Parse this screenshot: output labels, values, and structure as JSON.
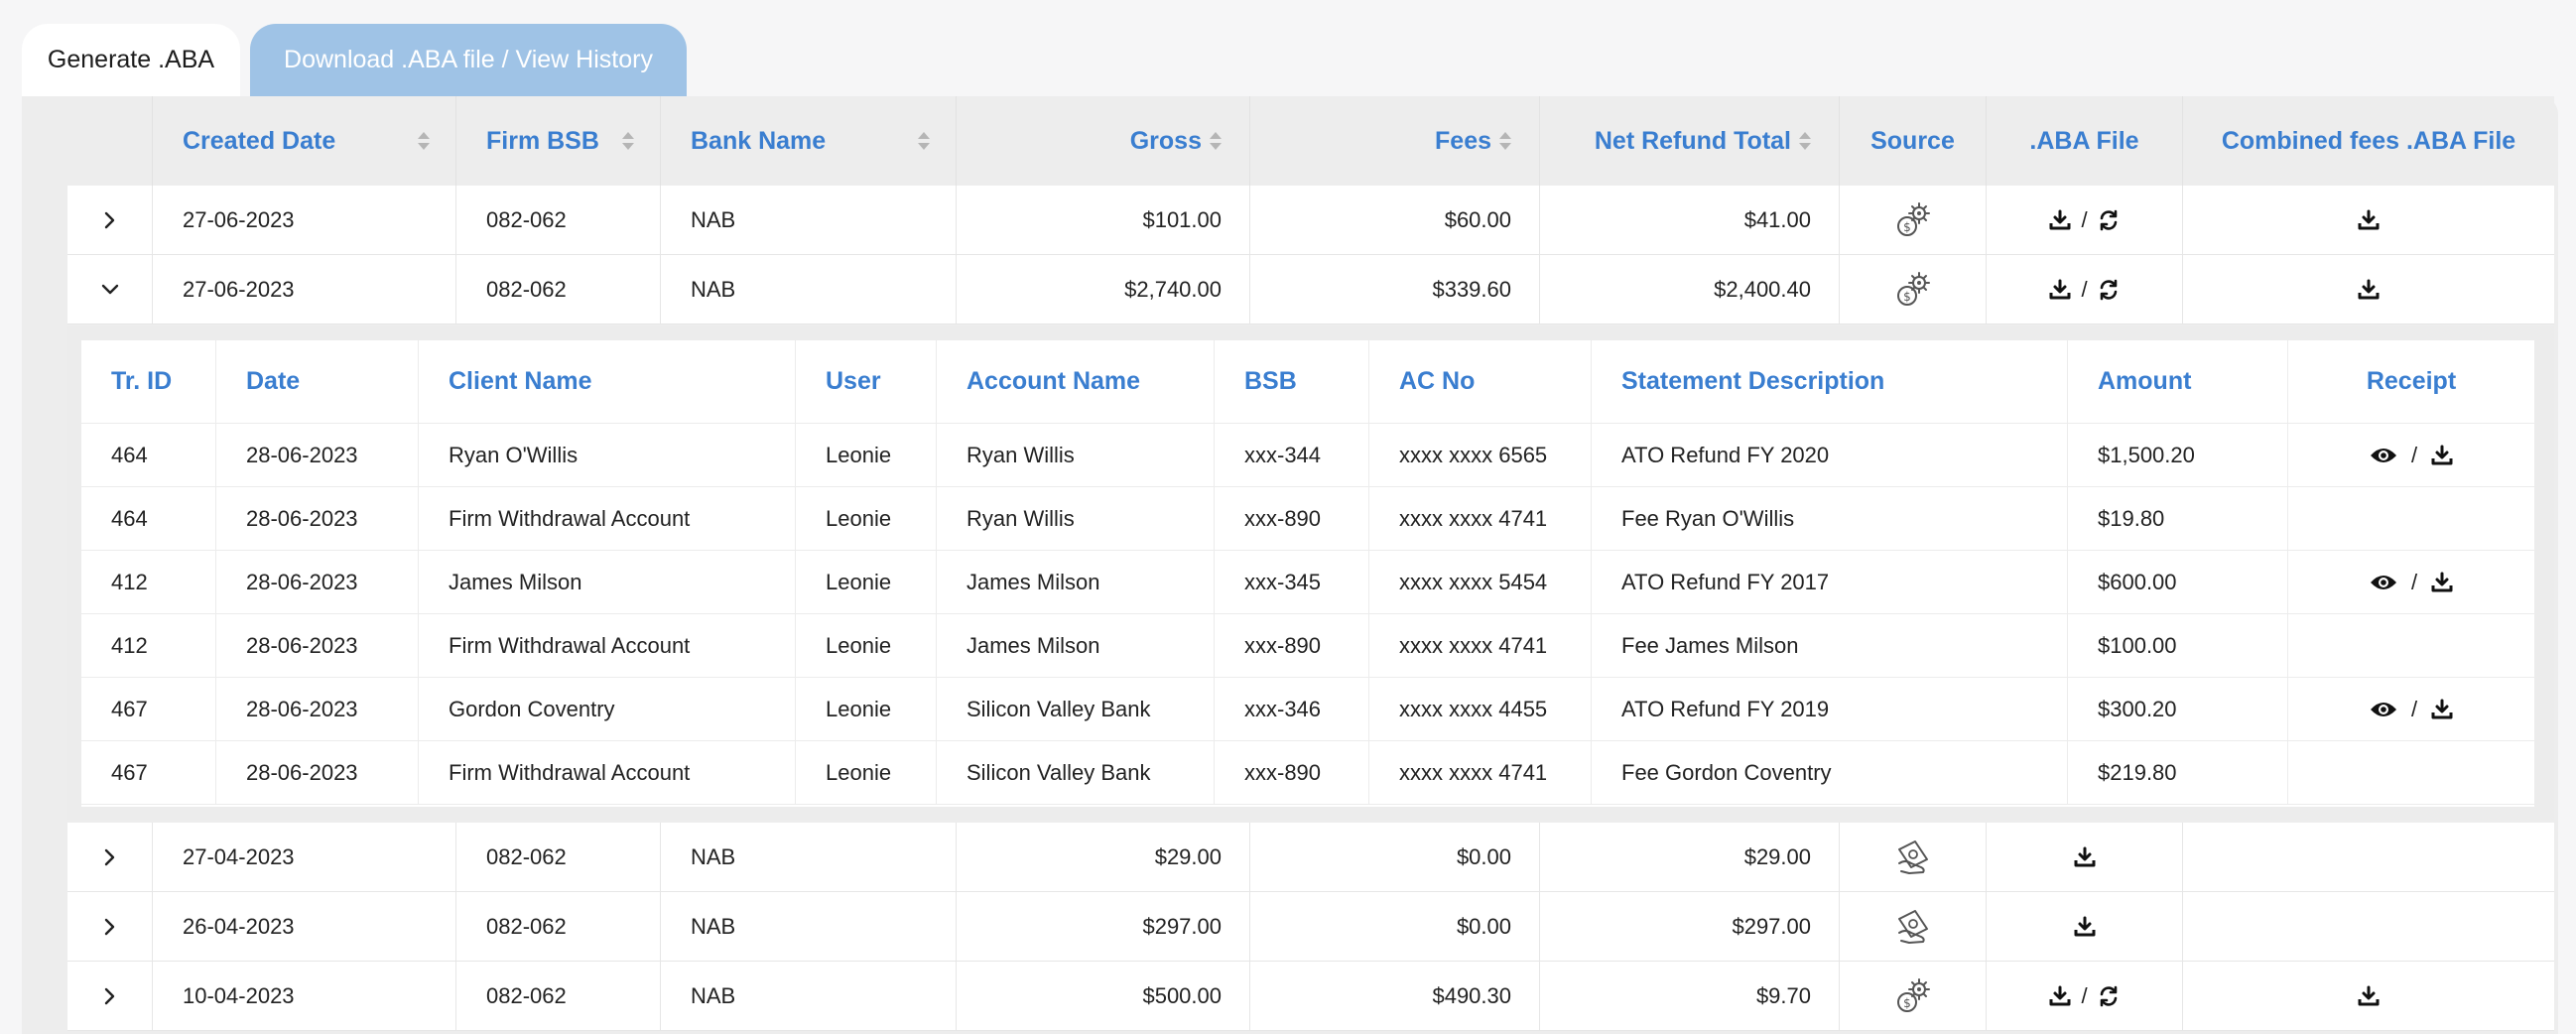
{
  "tabs": {
    "generate": "Generate .ABA",
    "download": "Download .ABA file / View History"
  },
  "main_headers": {
    "created_date": "Created Date",
    "firm_bsb": "Firm BSB",
    "bank_name": "Bank Name",
    "gross": "Gross",
    "fees": "Fees",
    "net_refund_total": "Net Refund Total",
    "source": "Source",
    "aba_file": ".ABA File",
    "combined_fees": "Combined fees .ABA File"
  },
  "rows": [
    {
      "date": "27-06-2023",
      "bsb": "082-062",
      "bank": "NAB",
      "gross": "$101.00",
      "fees": "$60.00",
      "net": "$41.00",
      "source_icon": "gear-dollar-icon",
      "aba": "download-refresh",
      "combined": true
    },
    {
      "date": "27-06-2023",
      "bsb": "082-062",
      "bank": "NAB",
      "gross": "$2,740.00",
      "fees": "$339.60",
      "net": "$2,400.40",
      "source_icon": "gear-dollar-icon",
      "aba": "download-refresh",
      "combined": true
    },
    {
      "date": "27-04-2023",
      "bsb": "082-062",
      "bank": "NAB",
      "gross": "$29.00",
      "fees": "$0.00",
      "net": "$29.00",
      "source_icon": "hand-money-icon",
      "aba": "download",
      "combined": false
    },
    {
      "date": "26-04-2023",
      "bsb": "082-062",
      "bank": "NAB",
      "gross": "$297.00",
      "fees": "$0.00",
      "net": "$297.00",
      "source_icon": "hand-money-icon",
      "aba": "download",
      "combined": false
    },
    {
      "date": "10-04-2023",
      "bsb": "082-062",
      "bank": "NAB",
      "gross": "$500.00",
      "fees": "$490.30",
      "net": "$9.70",
      "source_icon": "gear-dollar-icon",
      "aba": "download-refresh",
      "combined": true
    }
  ],
  "sub_headers": {
    "tr_id": "Tr. ID",
    "date": "Date",
    "client_name": "Client Name",
    "user": "User",
    "account_name": "Account Name",
    "bsb": "BSB",
    "ac_no": "AC No",
    "statement": "Statement Description",
    "amount": "Amount",
    "receipt": "Receipt"
  },
  "sub_rows": [
    {
      "id": "464",
      "date": "28-06-2023",
      "client": "Ryan O'Willis",
      "user": "Leonie",
      "account": "Ryan Willis",
      "bsb": "xxx-344",
      "acno": "xxxx xxxx 6565",
      "desc": "ATO Refund FY 2020",
      "amount": "$1,500.20",
      "receipt": true
    },
    {
      "id": "464",
      "date": "28-06-2023",
      "client": "Firm Withdrawal Account",
      "user": "Leonie",
      "account": "Ryan Willis",
      "bsb": "xxx-890",
      "acno": "xxxx xxxx 4741",
      "desc": "Fee Ryan O'Willis",
      "amount": "$19.80",
      "receipt": false
    },
    {
      "id": "412",
      "date": "28-06-2023",
      "client": "James Milson",
      "user": "Leonie",
      "account": "James Milson",
      "bsb": "xxx-345",
      "acno": "xxxx xxxx 5454",
      "desc": "ATO Refund FY 2017",
      "amount": "$600.00",
      "receipt": true
    },
    {
      "id": "412",
      "date": "28-06-2023",
      "client": "Firm Withdrawal Account",
      "user": "Leonie",
      "account": "James Milson",
      "bsb": "xxx-890",
      "acno": "xxxx xxxx 4741",
      "desc": "Fee James Milson",
      "amount": "$100.00",
      "receipt": false
    },
    {
      "id": "467",
      "date": "28-06-2023",
      "client": "Gordon Coventry",
      "user": "Leonie",
      "account": "Silicon Valley Bank",
      "bsb": "xxx-346",
      "acno": "xxxx xxxx 4455",
      "desc": "ATO Refund FY 2019",
      "amount": "$300.20",
      "receipt": true
    },
    {
      "id": "467",
      "date": "28-06-2023",
      "client": "Firm Withdrawal Account",
      "user": "Leonie",
      "account": "Silicon Valley Bank",
      "bsb": "xxx-890",
      "acno": "xxxx xxxx 4741",
      "desc": "Fee Gordon Coventry",
      "amount": "$219.80",
      "receipt": false
    }
  ],
  "separator": "/"
}
